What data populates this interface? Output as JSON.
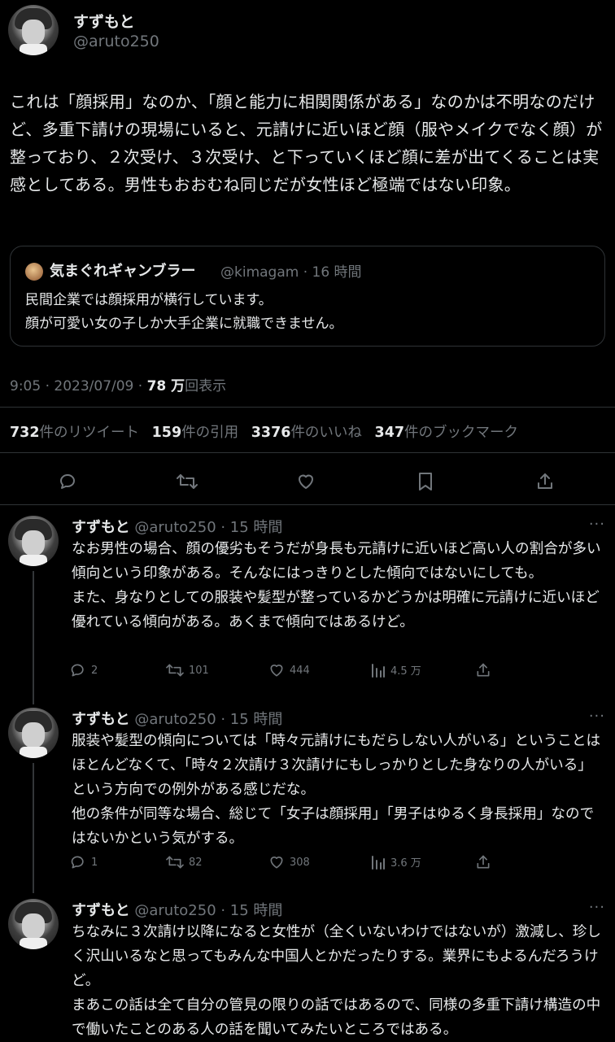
{
  "author": {
    "name": "すずもと",
    "handle": "@aruto250"
  },
  "main_tweet": {
    "text": "これは「顔採用」なのか、「顔と能力に相関関係がある」なのかは不明なのだけど、多重下請けの現場にいると、元請けに近いほど顔（服やメイクでなく顔）が整っており、２次受け、３次受け、と下っていくほど顔に差が出てくることは実感としてある。男性もおおむね同じだが女性ほど極端ではない印象。",
    "quote": {
      "name": "気まぐれギャンブラー",
      "handle_time": "@kimagam · 16 時間",
      "text": "民間企業では顔採用が横行しています。\n顔が可愛い女の子しか大手企業に就職できません。"
    },
    "time": "9:05 · 2023/07/09 · ",
    "views_count": "78 万",
    "views_label": "回表示",
    "stats": [
      {
        "count": "732",
        "label": "件のリツイート"
      },
      {
        "count": "159",
        "label": "件の引用"
      },
      {
        "count": "3376",
        "label": "件のいいね"
      },
      {
        "count": "347",
        "label": "件のブックマーク"
      }
    ]
  },
  "replies": [
    {
      "name": "すずもと",
      "handle_time": "@aruto250 · 15 時間",
      "text": "なお男性の場合、顔の優劣もそうだが身長も元請けに近いほど高い人の割合が多い傾向という印象がある。そんなにはっきりとした傾向ではないにしても。\nまた、身なりとしての服装や髪型が整っているかどうかは明確に元請けに近いほど優れている傾向がある。あくまで傾向ではあるけど。",
      "replies": "2",
      "retweets": "101",
      "likes": "444",
      "views": "4.5 万"
    },
    {
      "name": "すずもと",
      "handle_time": "@aruto250 · 15 時間",
      "text": "服装や髪型の傾向については「時々元請けにもだらしない人がいる」ということはほとんどなくて、「時々２次請け３次請けにもしっかりとした身なりの人がいる」という方向での例外がある感じだな。\n他の条件が同等な場合、総じて「女子は顔採用」「男子はゆるく身長採用」なのではないかという気がする。",
      "replies": "1",
      "retweets": "82",
      "likes": "308",
      "views": "3.6 万"
    },
    {
      "name": "すずもと",
      "handle_time": "@aruto250 · 15 時間",
      "text": "ちなみに３次請け以降になると女性が（全くいないわけではないが）激減し、珍しく沢山いるなと思ってもみんな中国人とかだったりする。業界にもよるんだろうけど。\nまあこの話は全て自分の管見の限りの話ではあるので、同様の多重下請け構造の中で働いたことのある人の話を聞いてみたいところではある。"
    }
  ],
  "more_label": "···",
  "icons": [
    "reply-icon",
    "retweet-icon",
    "like-icon",
    "bookmark-icon",
    "share-icon",
    "views-icon",
    "more-icon"
  ]
}
